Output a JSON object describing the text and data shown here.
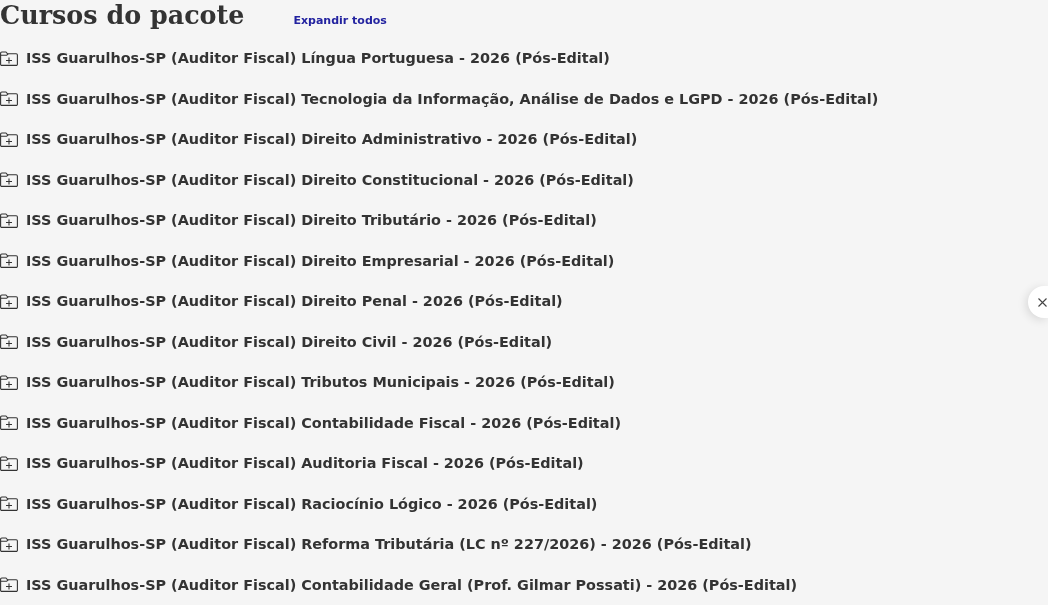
{
  "header": {
    "title": "Cursos do pacote",
    "expand_all": "Expandir todos"
  },
  "courses": [
    {
      "title": "ISS Guarulhos-SP (Auditor Fiscal) Língua Portuguesa - 2026 (Pós-Edital)",
      "expanded": false
    },
    {
      "title": "ISS Guarulhos-SP (Auditor Fiscal) Tecnologia da Informação, Análise de Dados e LGPD - 2026 (Pós-Edital)",
      "expanded": false
    },
    {
      "title": "ISS Guarulhos-SP (Auditor Fiscal) Direito Administrativo - 2026 (Pós-Edital)",
      "expanded": false
    },
    {
      "title": "ISS Guarulhos-SP (Auditor Fiscal) Direito Constitucional - 2026 (Pós-Edital)",
      "expanded": false
    },
    {
      "title": "ISS Guarulhos-SP (Auditor Fiscal) Direito Tributário - 2026 (Pós-Edital)",
      "expanded": false
    },
    {
      "title": "ISS Guarulhos-SP (Auditor Fiscal) Direito Empresarial - 2026 (Pós-Edital)",
      "expanded": false
    },
    {
      "title": "ISS Guarulhos-SP (Auditor Fiscal) Direito Penal - 2026 (Pós-Edital)",
      "expanded": false
    },
    {
      "title": "ISS Guarulhos-SP (Auditor Fiscal) Direito Civil - 2026 (Pós-Edital)",
      "expanded": false
    },
    {
      "title": "ISS Guarulhos-SP (Auditor Fiscal) Tributos Municipais - 2026 (Pós-Edital)",
      "expanded": false
    },
    {
      "title": "ISS Guarulhos-SP (Auditor Fiscal) Contabilidade Fiscal - 2026 (Pós-Edital)",
      "expanded": false
    },
    {
      "title": "ISS Guarulhos-SP (Auditor Fiscal) Auditoria Fiscal - 2026 (Pós-Edital)",
      "expanded": false
    },
    {
      "title": "ISS Guarulhos-SP (Auditor Fiscal) Raciocínio Lógico - 2026 (Pós-Edital)",
      "expanded": false
    },
    {
      "title": "ISS Guarulhos-SP (Auditor Fiscal) Reforma Tributária (LC nº 227/2026) - 2026 (Pós-Edital)",
      "expanded": false
    },
    {
      "title": "ISS Guarulhos-SP (Auditor Fiscal) Contabilidade Geral (Prof. Gilmar Possati) - 2026 (Pós-Edital)",
      "expanded": false
    }
  ]
}
